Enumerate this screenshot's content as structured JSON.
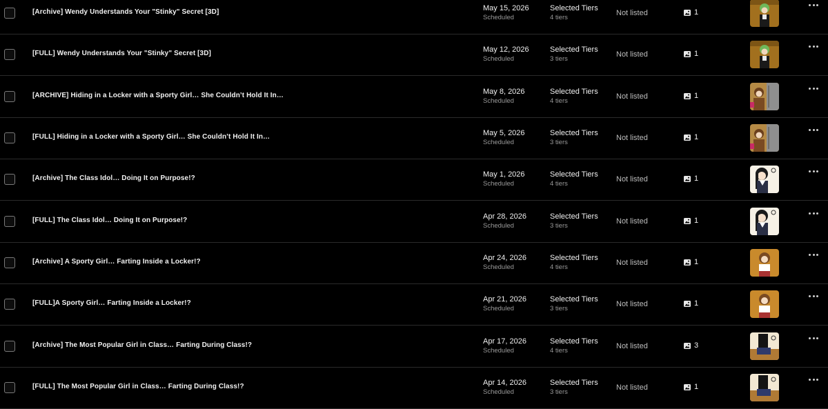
{
  "posts": [
    {
      "title": "[Archive] Wendy Understands Your \"Stinky\" Secret [3D]",
      "date": "May 15, 2026",
      "status": "Scheduled",
      "access": "Selected Tiers",
      "tiers": "4 tiers",
      "listing": "Not listed",
      "media_count": "1",
      "thumb_style": "green"
    },
    {
      "title": "[FULL] Wendy Understands Your \"Stinky\" Secret [3D]",
      "date": "May 12, 2026",
      "status": "Scheduled",
      "access": "Selected Tiers",
      "tiers": "3 tiers",
      "listing": "Not listed",
      "media_count": "1",
      "thumb_style": "green"
    },
    {
      "title": "[ARCHIVE] Hiding in a Locker with a Sporty Girl… She Couldn’t Hold It In…",
      "date": "May 8, 2026",
      "status": "Scheduled",
      "access": "Selected Tiers",
      "tiers": "4 tiers",
      "listing": "Not listed",
      "media_count": "1",
      "thumb_style": "locker"
    },
    {
      "title": "[FULL] Hiding in a Locker with a Sporty Girl… She Couldn’t Hold It In…",
      "date": "May 5, 2026",
      "status": "Scheduled",
      "access": "Selected Tiers",
      "tiers": "3 tiers",
      "listing": "Not listed",
      "media_count": "1",
      "thumb_style": "locker"
    },
    {
      "title": "[Archive] The Class Idol… Doing It on Purpose!?",
      "date": "May 1, 2026",
      "status": "Scheduled",
      "access": "Selected Tiers",
      "tiers": "4 tiers",
      "listing": "Not listed",
      "media_count": "1",
      "thumb_style": "idol"
    },
    {
      "title": "[FULL] The Class Idol… Doing It on Purpose!?",
      "date": "Apr 28, 2026",
      "status": "Scheduled",
      "access": "Selected Tiers",
      "tiers": "3 tiers",
      "listing": "Not listed",
      "media_count": "1",
      "thumb_style": "idol"
    },
    {
      "title": "[Archive] A Sporty Girl… Farting Inside a Locker!?",
      "date": "Apr 24, 2026",
      "status": "Scheduled",
      "access": "Selected Tiers",
      "tiers": "4 tiers",
      "listing": "Not listed",
      "media_count": "1",
      "thumb_style": "sporty"
    },
    {
      "title": "[FULL]A Sporty Girl… Farting Inside a Locker!?",
      "date": "Apr 21, 2026",
      "status": "Scheduled",
      "access": "Selected Tiers",
      "tiers": "3 tiers",
      "listing": "Not listed",
      "media_count": "1",
      "thumb_style": "sporty"
    },
    {
      "title": "[Archive] The Most Popular Girl in Class… Farting During Class!?",
      "date": "Apr 17, 2026",
      "status": "Scheduled",
      "access": "Selected Tiers",
      "tiers": "4 tiers",
      "listing": "Not listed",
      "media_count": "3",
      "thumb_style": "classroom"
    },
    {
      "title": "[FULL] The Most Popular Girl in Class… Farting During Class!?",
      "date": "Apr 14, 2026",
      "status": "Scheduled",
      "access": "Selected Tiers",
      "tiers": "3 tiers",
      "listing": "Not listed",
      "media_count": "1",
      "thumb_style": "classroom"
    }
  ],
  "icons": {
    "media": "image-icon",
    "menu": "more-horizontal-icon"
  },
  "colors": {
    "background": "#000000",
    "divider": "#2b2b2b",
    "secondary_text": "#9a9a9a"
  }
}
